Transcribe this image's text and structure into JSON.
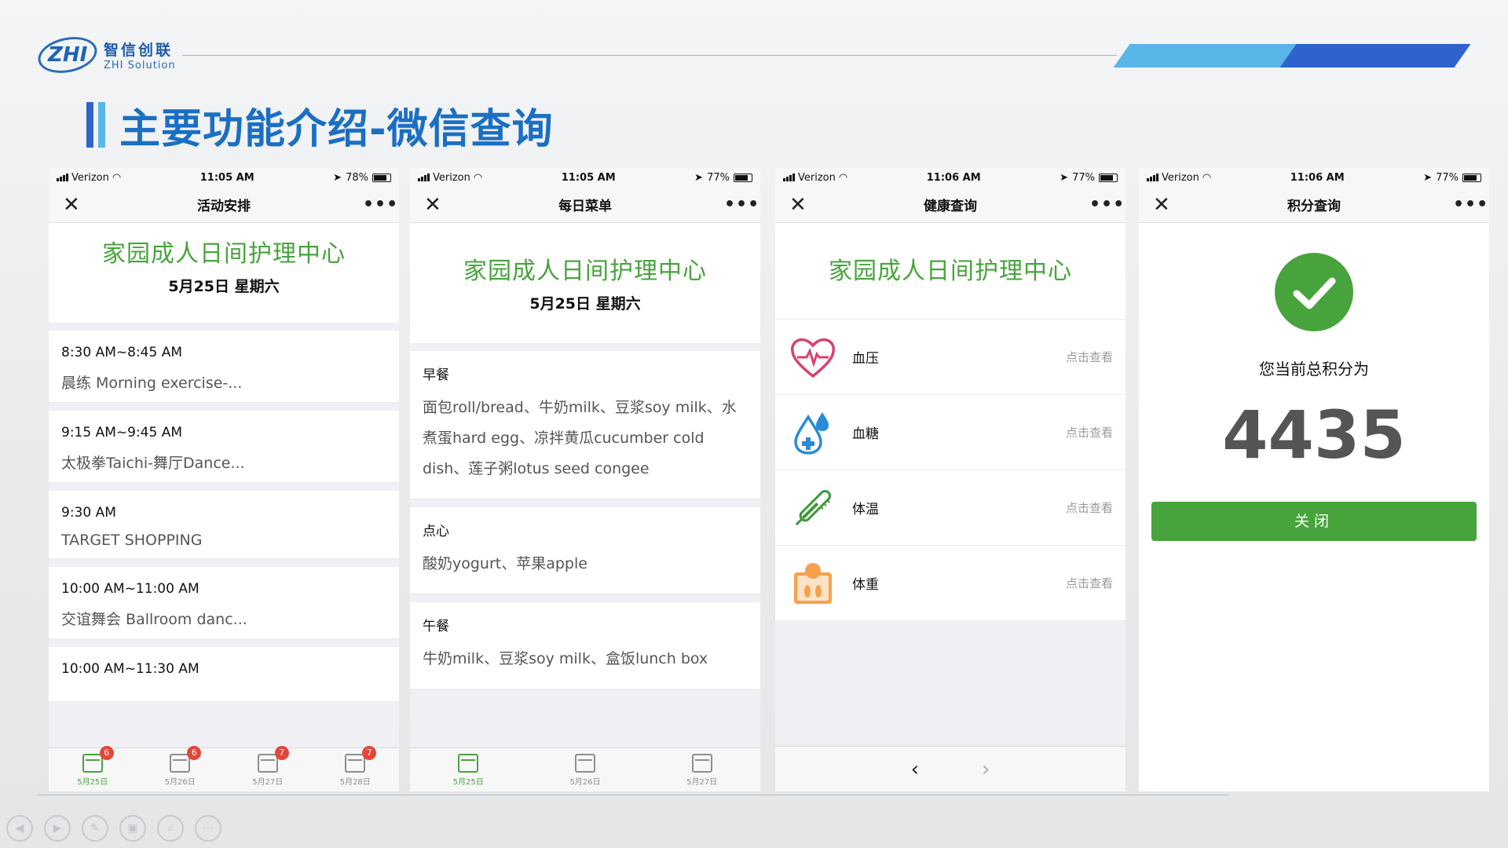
{
  "brand": {
    "logo_mark": "ZHI",
    "name_cn": "智信创联",
    "name_en": "ZHI Solution"
  },
  "slide": {
    "title": "主要功能介绍-微信查询"
  },
  "colors": {
    "accent_blue": "#1b6fc3",
    "green": "#47a43c",
    "band_light": "#5ab6e8",
    "band_dark": "#2f63cc",
    "badge_red": "#e5463a"
  },
  "center_name": "家园成人日间护理中心",
  "phones": [
    {
      "status": {
        "carrier": "Verizon",
        "time": "11:05 AM",
        "battery": "78%"
      },
      "nav_title": "活动安排",
      "date": "5月25日 星期六",
      "activities": [
        {
          "time": "8:30 AM~8:45 AM",
          "desc": "晨练 Morning exercise-..."
        },
        {
          "time": "9:15 AM~9:45 AM",
          "desc": "太极拳Taichi-舞厅Dance..."
        },
        {
          "time": "9:30 AM",
          "desc": "TARGET SHOPPING"
        },
        {
          "time": "10:00 AM~11:00 AM",
          "desc": "交谊舞会 Ballroom danc..."
        },
        {
          "time": "10:00 AM~11:30 AM",
          "desc": ""
        }
      ],
      "tabs": [
        {
          "label": "5月25日",
          "badge": "6"
        },
        {
          "label": "5月26日",
          "badge": "6"
        },
        {
          "label": "5月27日",
          "badge": "7"
        },
        {
          "label": "5月28日",
          "badge": "7"
        }
      ]
    },
    {
      "status": {
        "carrier": "Verizon",
        "time": "11:05 AM",
        "battery": "77%"
      },
      "nav_title": "每日菜单",
      "date": "5月25日 星期六",
      "meals": [
        {
          "name": "早餐",
          "items": "面包roll/bread、牛奶milk、豆浆soy milk、水煮蛋hard egg、凉拌黄瓜cucumber cold dish、莲子粥lotus seed congee"
        },
        {
          "name": "点心",
          "items": "酸奶yogurt、苹果apple"
        },
        {
          "name": "午餐",
          "items": "牛奶milk、豆浆soy milk、盒饭lunch box"
        }
      ],
      "tabs": [
        {
          "label": "5月25日"
        },
        {
          "label": "5月26日"
        },
        {
          "label": "5月27日"
        }
      ]
    },
    {
      "status": {
        "carrier": "Verizon",
        "time": "11:06 AM",
        "battery": "77%"
      },
      "nav_title": "健康查询",
      "health": [
        {
          "label": "血压",
          "action": "点击查看",
          "icon": "heart-pulse-icon"
        },
        {
          "label": "血糖",
          "action": "点击查看",
          "icon": "blood-drop-icon"
        },
        {
          "label": "体温",
          "action": "点击查看",
          "icon": "thermometer-icon"
        },
        {
          "label": "体重",
          "action": "点击查看",
          "icon": "weight-scale-icon"
        }
      ],
      "pager": {
        "prev": "‹",
        "next": "›"
      }
    },
    {
      "status": {
        "carrier": "Verizon",
        "time": "11:06 AM",
        "battery": "77%"
      },
      "nav_title": "积分查询",
      "score_label": "您当前总积分为",
      "score": "4435",
      "button": "关闭"
    }
  ],
  "nav_icons": {
    "close": "✕",
    "more": "•••"
  },
  "slideshow_controls": [
    "prev-icon",
    "next-icon",
    "pen-icon",
    "screens-icon",
    "zoom-icon",
    "more-icon"
  ]
}
